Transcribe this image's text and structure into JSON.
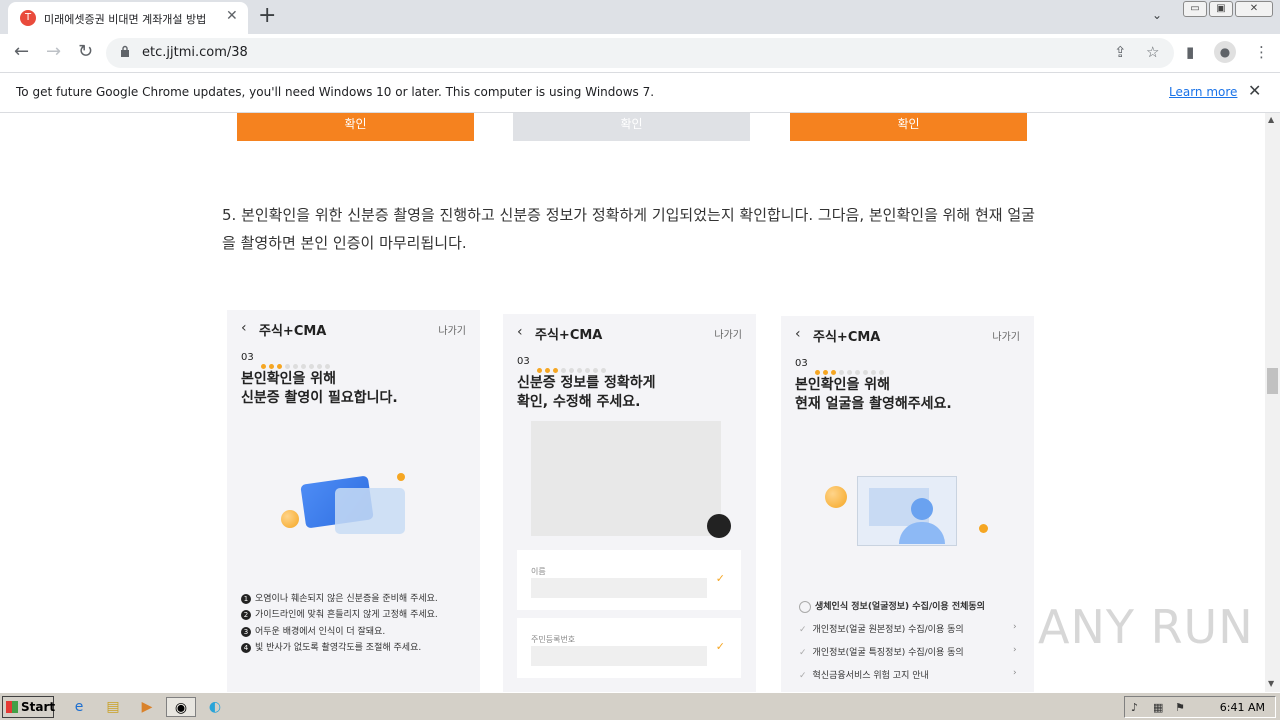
{
  "browser": {
    "tab_title": "미래에셋증권 비대면 계좌개설 방법",
    "tab_favicon": "T",
    "url": "etc.jjtmi.com/38",
    "win_min": "▭",
    "win_restore": "▣",
    "win_close": "✕"
  },
  "infobar": {
    "message": "To get future Google Chrome updates, you'll need Windows 10 or later. This computer is using Windows 7.",
    "learn_more": "Learn more"
  },
  "article": {
    "confirm_buttons": [
      "확인",
      "확인",
      "확인"
    ],
    "step5": "5. 본인확인을 위한 신분증 촬영을 진행하고 신분증 정보가 정확하게 기입되었는지 확인합니다. 그다음, 본인확인을 위해 현재 얼굴을 촬영하면 본인 인증이 마무리됩니다."
  },
  "phones": [
    {
      "title": "주식+CMA",
      "exit": "나가기",
      "step": "03",
      "heading1": "본인확인을 위해",
      "heading2": "신분증 촬영이 필요합니다.",
      "instructions": [
        {
          "num": "1",
          "text": "오염이나 훼손되지 않은 신분증을 준비해 주세요."
        },
        {
          "num": "2",
          "text": "가이드라인에 맞춰 흔들리지 않게 고정해 주세요."
        },
        {
          "num": "3",
          "text": "어두운 배경에서 인식이 더 잘돼요."
        },
        {
          "num": "4",
          "text": "빛 반사가 없도록 촬영각도를 조절해 주세요."
        }
      ]
    },
    {
      "title": "주식+CMA",
      "exit": "나가기",
      "step": "03",
      "heading1": "신분증 정보를 정확하게",
      "heading2": "확인, 수정해 주세요.",
      "fields": [
        "이름",
        "주민등록번호"
      ]
    },
    {
      "title": "주식+CMA",
      "exit": "나가기",
      "step": "03",
      "heading1": "본인확인을 위해",
      "heading2": "현재 얼굴을 촬영해주세요.",
      "agree_all": "생체인식 정보(얼굴정보) 수집/이용 전체동의",
      "agree_items": [
        "개인정보(얼굴 원본정보) 수집/이용 동의",
        "개인정보(얼굴 특징정보) 수집/이용 동의",
        "혁신금융서비스 위험 고지 안내"
      ]
    }
  ],
  "taskbar": {
    "start": "Start",
    "clock": "6:41 AM"
  },
  "watermark": "ANY RUN",
  "colors": {
    "orange": "#f5821f",
    "disabled": "#dfe1e5",
    "accent_dot": "#f5a623"
  }
}
